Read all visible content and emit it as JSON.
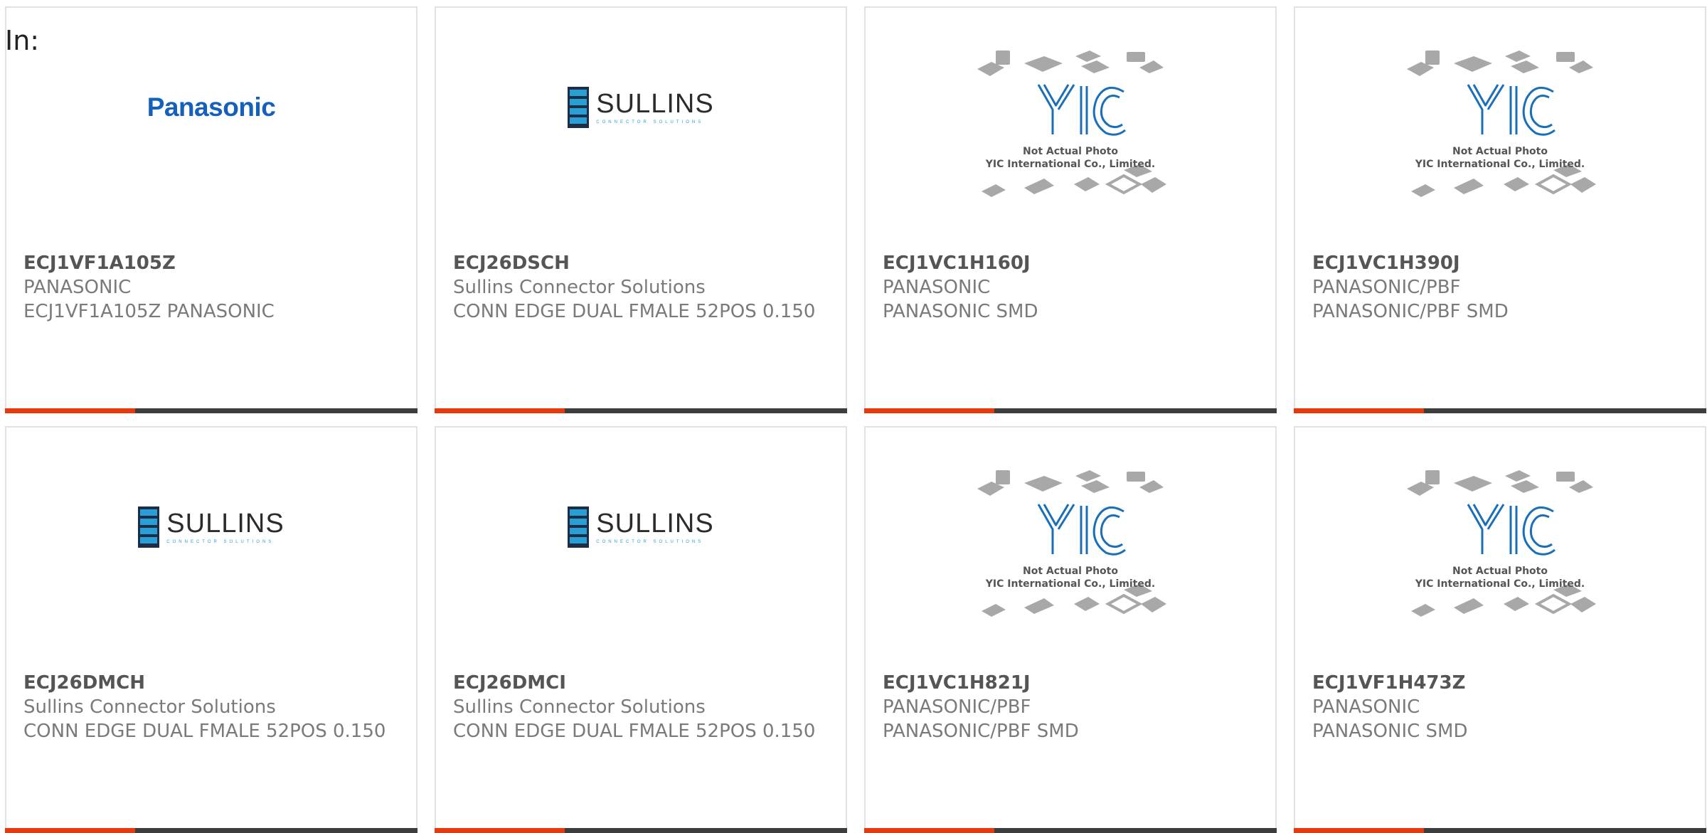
{
  "heading": "In:",
  "colors": {
    "accent": "#e8380d",
    "bar": "#3d3d3d",
    "panasonic_blue": "#1560bd",
    "sullins_blue": "#2a9fd6"
  },
  "products": [
    {
      "part": "ECJ1VF1A105Z",
      "maker": "PANASONIC",
      "desc": "ECJ1VF1A105Z PANASONIC",
      "image": "panasonic-logo",
      "logo_text": "Panasonic"
    },
    {
      "part": "ECJ26DSCH",
      "maker": "Sullins Connector Solutions",
      "desc": "CONN EDGE DUAL FMALE 52POS 0.150",
      "image": "sullins-logo",
      "logo_text": "SULLINS",
      "logo_sub": "CONNECTOR SOLUTIONS"
    },
    {
      "part": "ECJ1VC1H160J",
      "maker": "PANASONIC",
      "desc": "PANASONIC SMD",
      "image": "yic-placeholder",
      "logo_text": "YIC",
      "note1": "Not Actual Photo",
      "note2": "YIC International Co., Limited."
    },
    {
      "part": "ECJ1VC1H390J",
      "maker": "PANASONIC/PBF",
      "desc": "PANASONIC/PBF SMD",
      "image": "yic-placeholder",
      "logo_text": "YIC",
      "note1": "Not Actual Photo",
      "note2": "YIC International Co., Limited."
    },
    {
      "part": "ECJ26DMCH",
      "maker": "Sullins Connector Solutions",
      "desc": "CONN EDGE DUAL FMALE 52POS 0.150",
      "image": "sullins-logo",
      "logo_text": "SULLINS",
      "logo_sub": "CONNECTOR SOLUTIONS"
    },
    {
      "part": "ECJ26DMCI",
      "maker": "Sullins Connector Solutions",
      "desc": "CONN EDGE DUAL FMALE 52POS 0.150",
      "image": "sullins-logo",
      "logo_text": "SULLINS",
      "logo_sub": "CONNECTOR SOLUTIONS"
    },
    {
      "part": "ECJ1VC1H821J",
      "maker": "PANASONIC/PBF",
      "desc": "PANASONIC/PBF SMD",
      "image": "yic-placeholder",
      "logo_text": "YIC",
      "note1": "Not Actual Photo",
      "note2": "YIC International Co., Limited."
    },
    {
      "part": "ECJ1VF1H473Z",
      "maker": "PANASONIC",
      "desc": "PANASONIC SMD",
      "image": "yic-placeholder",
      "logo_text": "YIC",
      "note1": "Not Actual Photo",
      "note2": "YIC International Co., Limited."
    }
  ]
}
